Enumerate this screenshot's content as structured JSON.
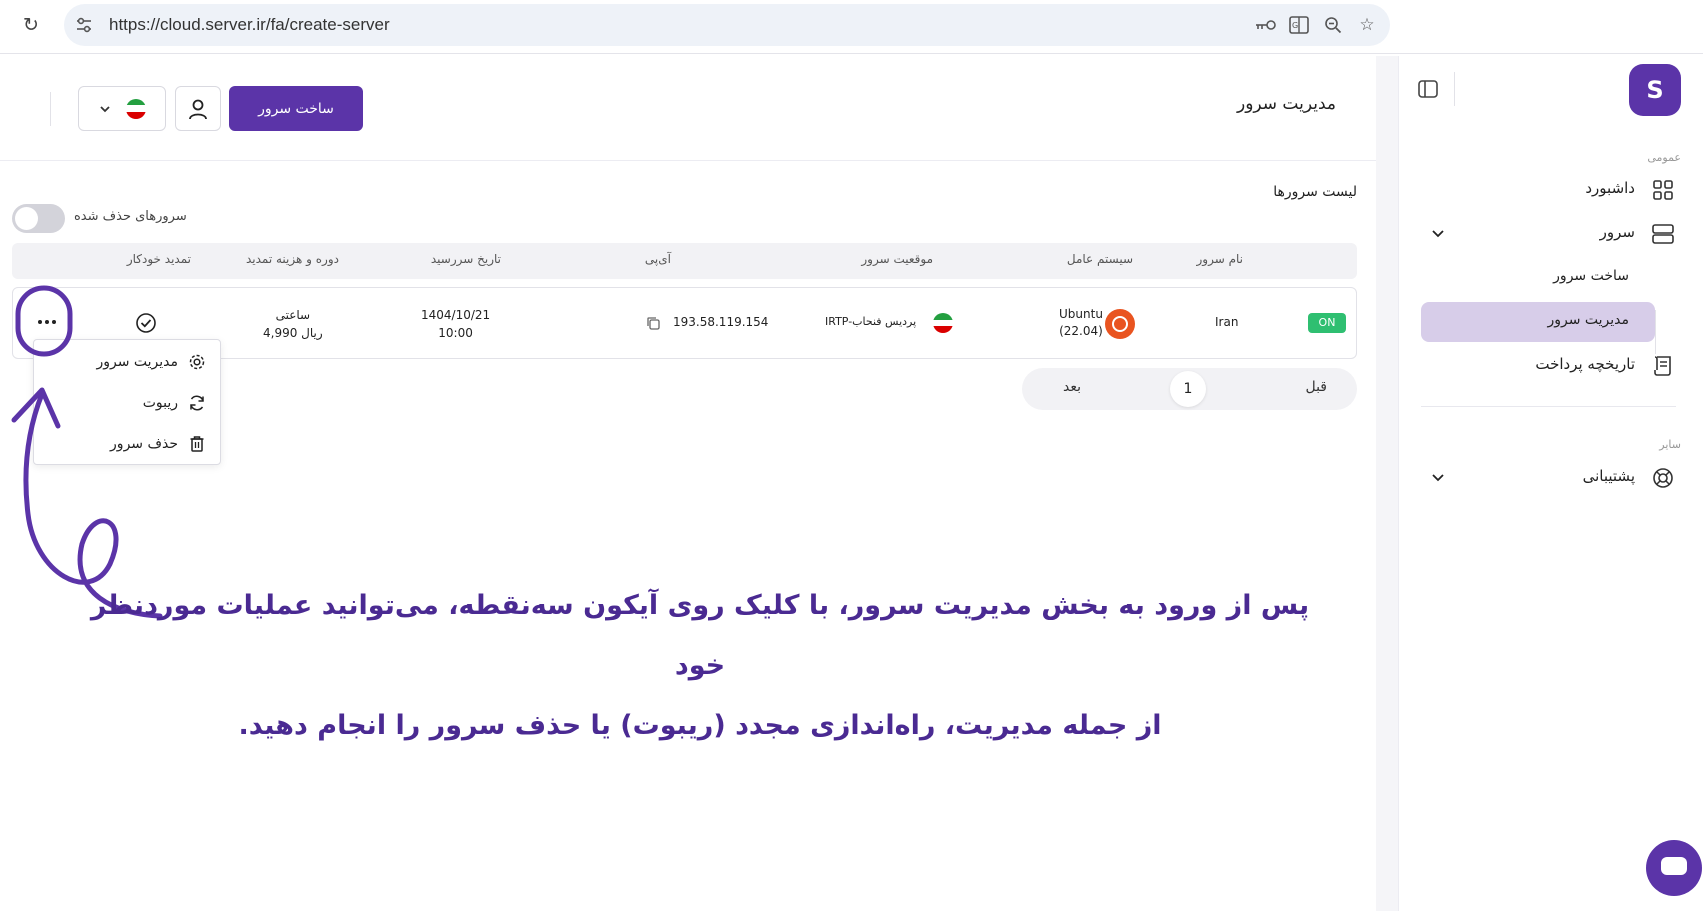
{
  "browser": {
    "url": "https://cloud.server.ir/fa/create-server"
  },
  "header": {
    "title": "مدیریت سرور",
    "create_button": "ساخت سرور"
  },
  "servers": {
    "list_title": "لیست سرورها",
    "deleted_toggle_label": "سرورهای حذف شده",
    "columns": {
      "name": "نام سرور",
      "os": "سیستم عامل",
      "location": "موقعیت سرور",
      "ip": "آی‌پی",
      "expiry": "تاریخ سررسید",
      "period": "دوره و هزینه تمدید",
      "auto_renew": "تمدید خودکار"
    },
    "rows": [
      {
        "status": "ON",
        "name": "Iran",
        "os_name": "Ubuntu",
        "os_version": "(22.04)",
        "location": "IRTP-پردیس فنحاب",
        "ip": "193.58.119.154",
        "expiry_date": "1404/10/21",
        "expiry_time": "10:00",
        "period": "ساعتی",
        "price": "4,990 ریال"
      }
    ]
  },
  "dropdown": {
    "items": [
      {
        "label": "مدیریت سرور",
        "icon": "gear-icon"
      },
      {
        "label": "ریبوت",
        "icon": "refresh-icon"
      },
      {
        "label": "حذف سرور",
        "icon": "trash-icon"
      }
    ]
  },
  "pagination": {
    "prev": "قبل",
    "page": "1",
    "next": "بعد"
  },
  "annotation": {
    "line1": "پس از ورود به بخش مدیریت سرور، با کلیک روی آیکون سه‌نقطه، می‌توانید عملیات موردنظر خود",
    "line2": "از جمله مدیریت، راه‌اندازی مجدد (ریبوت) یا حذف سرور را انجام دهید."
  },
  "sidebar": {
    "logo": "S",
    "section_general": "عمومی",
    "section_other": "سایر",
    "items": [
      {
        "label": "داشبورد"
      },
      {
        "label": "سرور"
      },
      {
        "label": "ساخت سرور"
      },
      {
        "label": "مدیریت سرور"
      },
      {
        "label": "تاریخچه پرداخت"
      },
      {
        "label": "پشتیبانی"
      }
    ]
  },
  "colors": {
    "brand": "#5b34a8",
    "active_nav": "#d7cde9",
    "status_on": "#2fbf71",
    "annotation": "#4a2a92"
  }
}
